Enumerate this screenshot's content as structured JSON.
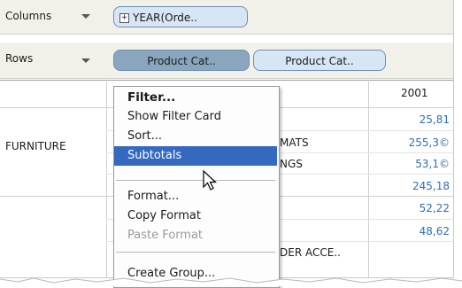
{
  "shelves": {
    "columns": {
      "label": "Columns",
      "pill": "YEAR(Orde..",
      "expand_glyph": "+"
    },
    "rows": {
      "label": "Rows",
      "pills": [
        "Product Cat..",
        "Product Cat.."
      ]
    }
  },
  "table": {
    "year_header": "2001",
    "category": "FURNITURE",
    "subcategories": [
      "MATS",
      "NGS",
      "DER ACCE.."
    ],
    "values": [
      "25,81",
      "255,3©",
      "53,1©",
      "245,18",
      "52,22",
      "48,62"
    ]
  },
  "menu": {
    "items": [
      "Filter...",
      "Show Filter Card",
      "Sort...",
      "Subtotals",
      "Format...",
      "Copy Format",
      "Paste Format",
      "Create Group..."
    ],
    "selected": "Subtotals",
    "colors": {
      "highlight": "#3569c0",
      "pill": "#8aa6bf"
    }
  }
}
